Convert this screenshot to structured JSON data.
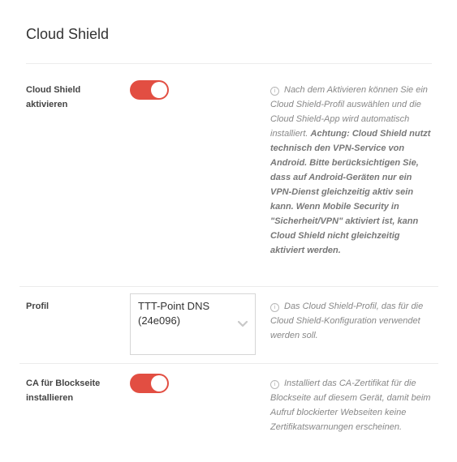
{
  "page": {
    "title": "Cloud Shield"
  },
  "cloud_shield": {
    "label": "Cloud Shield aktivieren",
    "enabled": true,
    "help_text": "Nach dem Aktivieren können Sie ein Cloud Shield-Profil auswählen und die Cloud Shield-App wird automatisch installiert.",
    "help_warning": "Achtung: Cloud Shield nutzt technisch den VPN-Service von Android. Bitte berücksichtigen Sie, dass auf Android-Geräten nur ein VPN-Dienst gleichzeitig aktiv sein kann. Wenn Mobile Security in \"Sicherheit/VPN\" aktiviert ist, kann Cloud Shield nicht gleichzeitig aktiviert werden."
  },
  "profile": {
    "label": "Profil",
    "selected_value": "TTT-Point DNS (24e096)",
    "help_text": "Das Cloud Shield-Profil, das für die Cloud Shield-Konfiguration verwendet werden soll."
  },
  "ca_block": {
    "label": "CA für Blockseite installieren",
    "enabled": true,
    "help_text": "Installiert das CA-Zertifikat für die Blockseite auf diesem Gerät, damit beim Aufruf blockierter Webseiten keine Zertifikatswarnungen erscheinen."
  },
  "colors": {
    "toggle_on": "#e24e42"
  },
  "icons": {
    "info": "info-icon",
    "chevron": "chevron-down-icon"
  }
}
